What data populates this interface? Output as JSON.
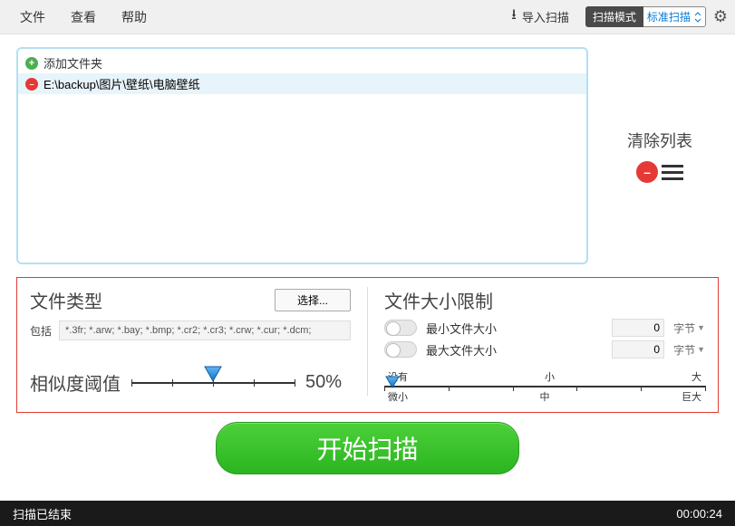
{
  "menu": {
    "file": "文件",
    "view": "查看",
    "help": "帮助"
  },
  "toolbar": {
    "import": "导入扫描",
    "scan_mode_label": "扫描模式",
    "scan_mode_value": "标准扫描"
  },
  "folders": {
    "add_label": "添加文件夹",
    "paths": [
      "E:\\backup\\图片\\壁纸\\电脑壁纸"
    ]
  },
  "clear": {
    "label": "清除列表"
  },
  "filter": {
    "filetype_label": "文件类型",
    "select_btn": "选择...",
    "include_label": "包括",
    "include_value": "*.3fr; *.arw; *.bay; *.bmp; *.cr2; *.cr3; *.crw; *.cur; *.dcm;",
    "threshold_label": "相似度阈值",
    "threshold_value": "50%",
    "size_title": "文件大小限制",
    "min_label": "最小文件大小",
    "max_label": "最大文件大小",
    "min_value": "0",
    "max_value": "0",
    "unit": "字节",
    "ruler_top": [
      "没有",
      "小",
      "大"
    ],
    "ruler_bottom": [
      "微小",
      "中",
      "巨大"
    ]
  },
  "scan_btn": "开始扫描",
  "status": {
    "text": "扫描已结束",
    "time": "00:00:24"
  }
}
